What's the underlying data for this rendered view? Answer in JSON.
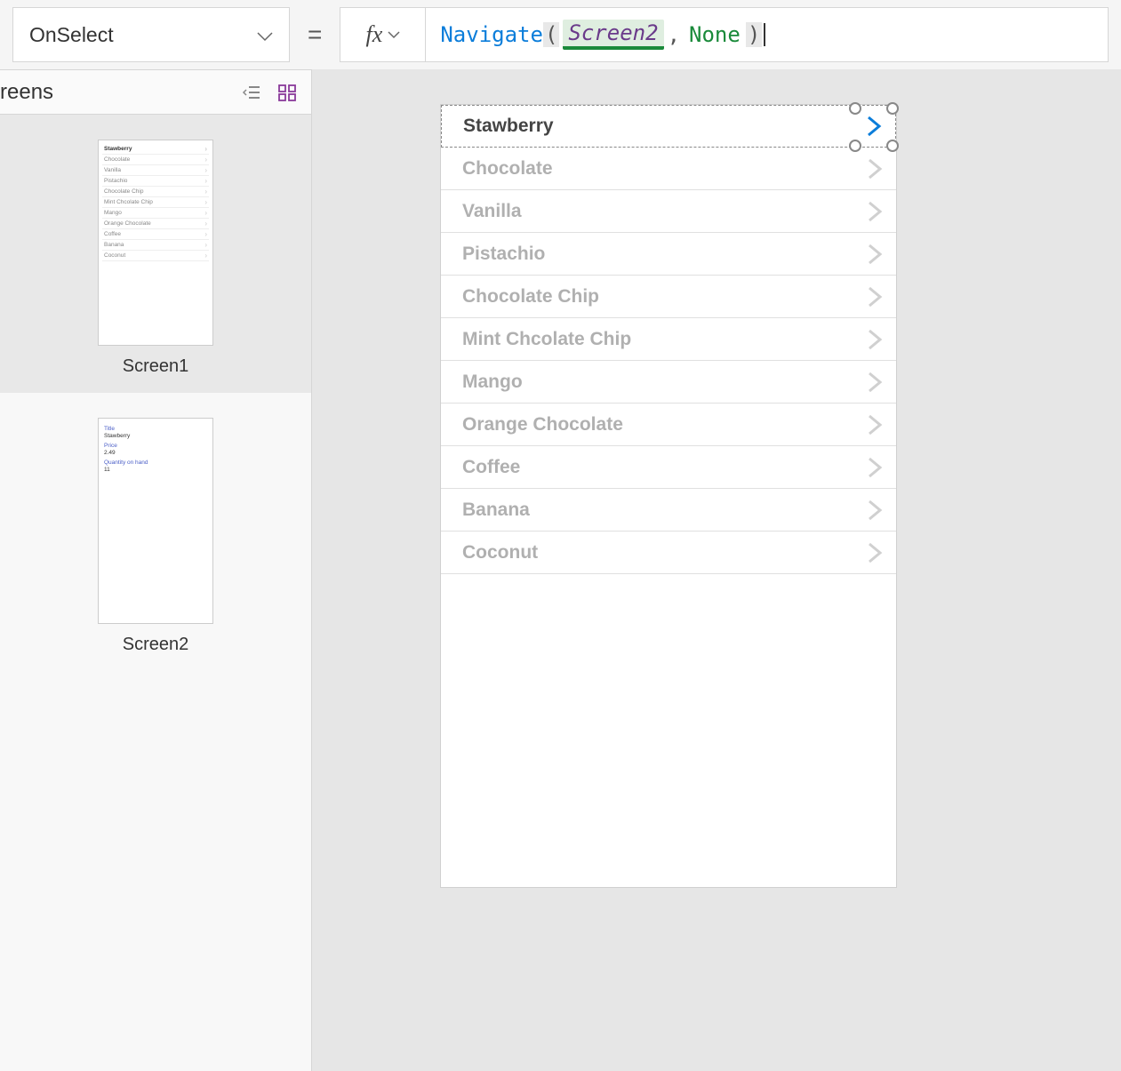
{
  "property_selector": {
    "value": "OnSelect"
  },
  "formula": {
    "navigate": "Navigate",
    "screen2": "Screen2",
    "none": "None"
  },
  "screens_panel": {
    "title": "reens",
    "screen1": {
      "name": "Screen1"
    },
    "screen2": {
      "name": "Screen2",
      "fields": {
        "title_label": "Title",
        "title_value": "Stawberry",
        "price_label": "Price",
        "price_value": "2.49",
        "qty_label": "Quantity on hand",
        "qty_value": "11"
      }
    }
  },
  "gallery": {
    "items": [
      "Stawberry",
      "Chocolate",
      "Vanilla",
      "Pistachio",
      "Chocolate Chip",
      "Mint Chcolate Chip",
      "Mango",
      "Orange Chocolate",
      "Coffee",
      "Banana",
      "Coconut"
    ]
  }
}
